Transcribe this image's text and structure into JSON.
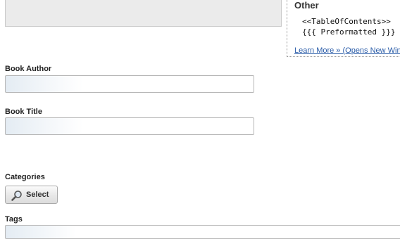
{
  "help": {
    "heading": "Other",
    "code_lines": [
      "<<TableOfContents>>",
      "{{{ Preformatted }}}"
    ],
    "learn_more": "Learn More » (Opens New Win"
  },
  "form": {
    "author_label": "Book Author",
    "author_value": "",
    "title_label": "Book Title",
    "title_value": "",
    "categories_label": "Categories",
    "select_label": "Select",
    "tags_label": "Tags",
    "tags_value": ""
  },
  "icons": {
    "select_icon": "magnifier-icon"
  }
}
